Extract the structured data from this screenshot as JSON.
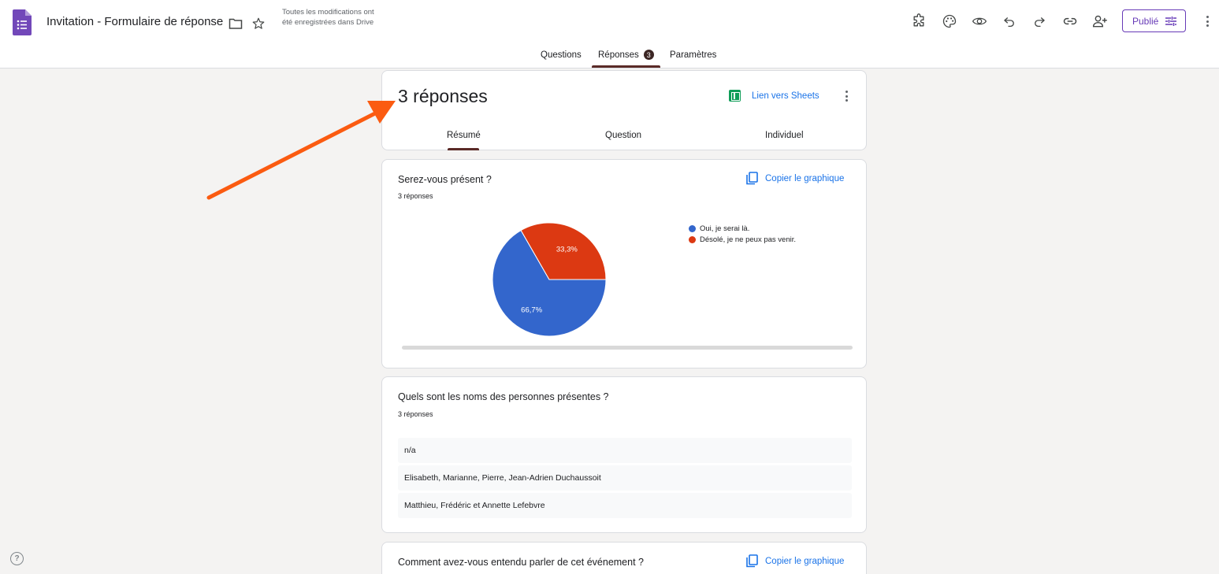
{
  "header": {
    "title": "Invitation - Formulaire de réponse",
    "save_status": "Toutes les modifications ont été enregistrées dans Drive",
    "publish_label": "Publié"
  },
  "tabs": [
    {
      "label": "Questions"
    },
    {
      "label": "Réponses",
      "badge": "3"
    },
    {
      "label": "Paramètres"
    }
  ],
  "summary_card": {
    "count": "3 réponses",
    "sheets_link": "Lien vers Sheets",
    "subtabs": [
      "Résumé",
      "Question",
      "Individuel"
    ]
  },
  "question1": {
    "title": "Serez-vous présent ?",
    "sub": "3 réponses",
    "copy_label": "Copier le graphique"
  },
  "chart_data": {
    "type": "pie",
    "categories": [
      "Oui, je serai là.",
      "Désolé, je ne peux pas venir."
    ],
    "values": [
      66.7,
      33.3
    ],
    "labels": [
      "66,7%",
      "33,3%"
    ],
    "colors": [
      "#3366cc",
      "#dc3912"
    ],
    "legend": "right"
  },
  "question2": {
    "title": "Quels sont les noms des personnes présentes ?",
    "sub": "3 réponses",
    "answers": [
      "n/a",
      "Elisabeth, Marianne, Pierre, Jean-Adrien Duchaussoit",
      "Matthieu, Frédéric et Annette Lefebvre"
    ]
  },
  "question3": {
    "title": "Comment avez-vous entendu parler de cet événement ?",
    "copy_label": "Copier le graphique"
  },
  "colors": {
    "accent": "#673ab7",
    "link": "#1a73e8",
    "arrow": "#fb5b11"
  }
}
